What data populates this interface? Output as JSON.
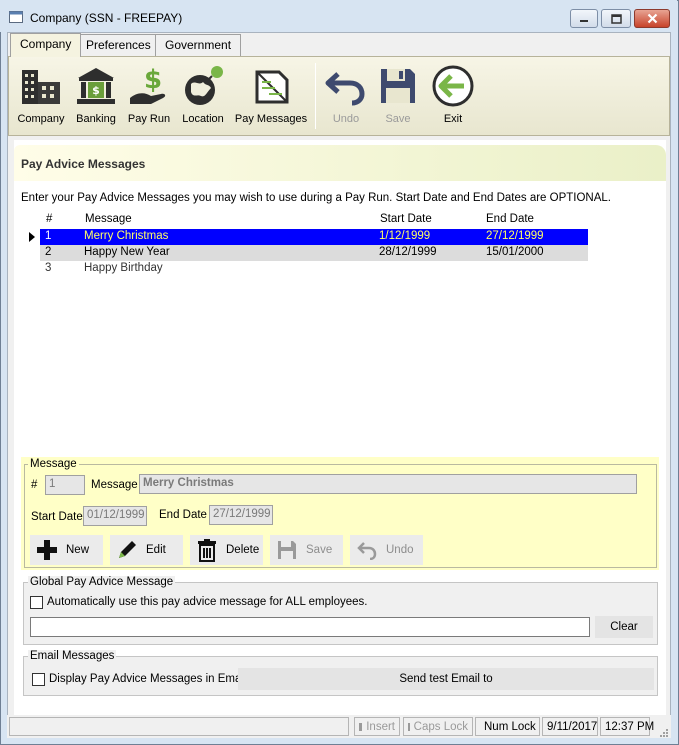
{
  "window": {
    "title": "Company (SSN - FREEPAY)"
  },
  "tabs": [
    {
      "label": "Company",
      "active": true
    },
    {
      "label": "Preferences",
      "active": false
    },
    {
      "label": "Government",
      "active": false
    }
  ],
  "toolbar": [
    {
      "label": "Company",
      "icon": "company-building-icon",
      "enabled": true
    },
    {
      "label": "Banking",
      "icon": "bank-icon",
      "enabled": true
    },
    {
      "label": "Pay Run",
      "icon": "pay-run-dollar-hand-icon",
      "enabled": true
    },
    {
      "label": "Location",
      "icon": "globe-location-icon",
      "enabled": true
    },
    {
      "label": "Pay Messages",
      "icon": "pay-messages-icon",
      "enabled": true
    },
    {
      "label": "Undo",
      "icon": "undo-icon",
      "enabled": false
    },
    {
      "label": "Save",
      "icon": "save-disk-icon",
      "enabled": false
    },
    {
      "label": "Exit",
      "icon": "exit-arrow-icon",
      "enabled": true
    }
  ],
  "section": {
    "title": "Pay Advice Messages",
    "instructions": "Enter your Pay Advice Messages you may wish to use during a Pay Run.  Start Date and End Dates are OPTIONAL."
  },
  "grid": {
    "columns": [
      "#",
      "Message",
      "Start Date",
      "End Date"
    ],
    "rows": [
      {
        "num": "1",
        "message": "Merry Christmas",
        "start": "1/12/1999",
        "end": "27/12/1999",
        "selected": true
      },
      {
        "num": "2",
        "message": "Happy New Year",
        "start": "28/12/1999",
        "end": "15/01/2000",
        "selected": false
      },
      {
        "num": "3",
        "message": "Happy Birthday",
        "start": "",
        "end": "",
        "selected": false
      }
    ]
  },
  "message_box": {
    "legend": "Message",
    "num_label": "#",
    "num_value": "1",
    "message_label": "Message",
    "message_value": "Merry Christmas",
    "start_label": "Start Date",
    "start_value": "01/12/1999",
    "end_label": "End Date",
    "end_value": "27/12/1999",
    "buttons": {
      "new": "New",
      "edit": "Edit",
      "delete": "Delete",
      "save": "Save",
      "undo": "Undo"
    }
  },
  "global_box": {
    "legend": "Global Pay Advice Message",
    "checkbox_label": "Automatically use this pay advice message for ALL employees.",
    "text_value": "",
    "clear_label": "Clear"
  },
  "email_box": {
    "legend": "Email Messages",
    "checkbox_label": "Display Pay Advice Messages in Email.",
    "send_label": "Send test Email to"
  },
  "statusbar": {
    "insert": "Insert",
    "caps": "Caps Lock",
    "num": "Num Lock",
    "date": "9/11/2017",
    "time": "12:37 PM"
  },
  "colors": {
    "selection": "#0000ff",
    "selected_text_primary": "#ffffff",
    "selected_text_secondary": "#ffff66",
    "alt_row": "#dcdcdc",
    "message_panel": "#ffffc7",
    "header_gradient_end": "#eaf0c8",
    "led_on": "#e00000",
    "led_off": "#9a9a9a"
  }
}
